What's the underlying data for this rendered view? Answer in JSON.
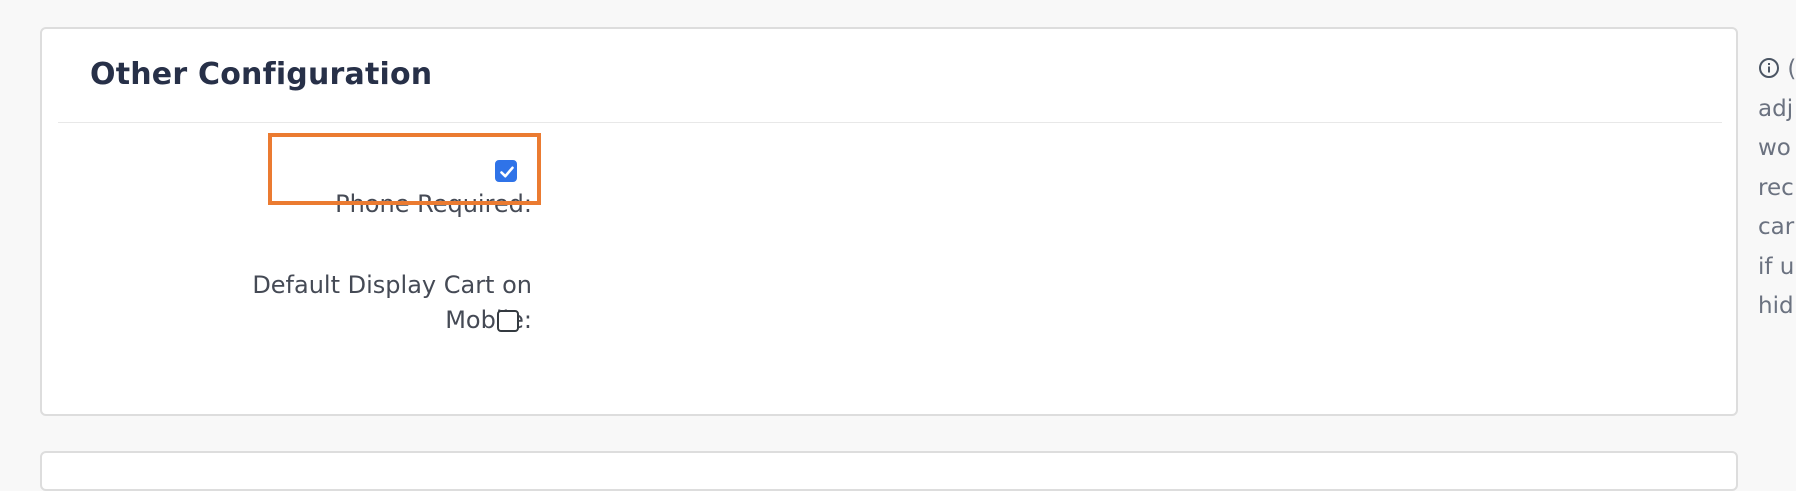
{
  "section": {
    "title": "Other Configuration"
  },
  "fields": {
    "phone_required": {
      "label": "Phone Required:",
      "checked": true
    },
    "default_display_cart_mobile": {
      "label_line1": "Default Display Cart on",
      "label_line2": "Mobile:",
      "checked": false
    }
  },
  "side_note": {
    "icon": "info-icon",
    "lines": [
      "(",
      "adj",
      "wo",
      "rec",
      "car",
      "if u",
      "hid"
    ]
  },
  "colors": {
    "highlight": "#eb7b31",
    "checkbox_checked": "#2f73e8"
  }
}
